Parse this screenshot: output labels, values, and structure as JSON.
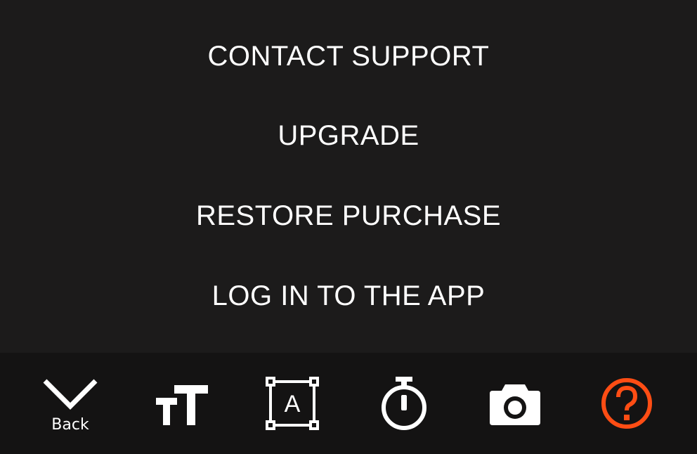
{
  "menu": {
    "items": [
      {
        "label": "CONTACT SUPPORT"
      },
      {
        "label": "UPGRADE"
      },
      {
        "label": "RESTORE PURCHASE"
      },
      {
        "label": "LOG IN TO THE APP"
      }
    ]
  },
  "toolbar": {
    "back_label": "Back",
    "text_frame_letter": "A",
    "tools": [
      {
        "icon": "chevron-down-icon"
      },
      {
        "icon": "text-size-icon"
      },
      {
        "icon": "text-frame-icon"
      },
      {
        "icon": "timer-icon"
      },
      {
        "icon": "camera-icon"
      },
      {
        "icon": "help-icon"
      }
    ]
  },
  "colors": {
    "background": "#1c1b1b",
    "toolbar_background": "#141313",
    "text": "#ffffff",
    "accent": "#ff4d14"
  }
}
